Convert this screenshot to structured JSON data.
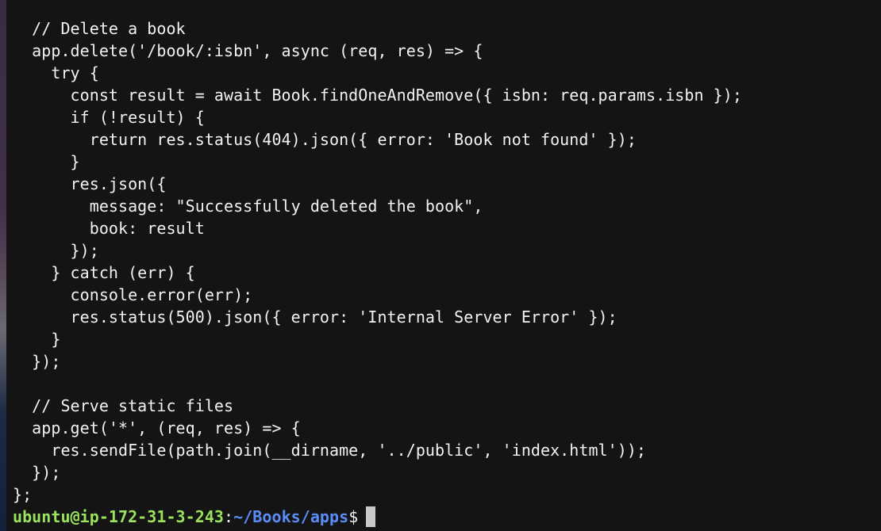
{
  "terminal": {
    "code_lines": [
      "  // Delete a book",
      "  app.delete('/book/:isbn', async (req, res) => {",
      "    try {",
      "      const result = await Book.findOneAndRemove({ isbn: req.params.isbn });",
      "      if (!result) {",
      "        return res.status(404).json({ error: 'Book not found' });",
      "      }",
      "      res.json({",
      "        message: \"Successfully deleted the book\",",
      "        book: result",
      "      });",
      "    } catch (err) {",
      "      console.error(err);",
      "      res.status(500).json({ error: 'Internal Server Error' });",
      "    }",
      "  });",
      "",
      "  // Serve static files",
      "  app.get('*', (req, res) => {",
      "    res.sendFile(path.join(__dirname, '../public', 'index.html'));",
      "  });",
      "};"
    ],
    "prompt": {
      "user_host": "ubuntu@ip-172-31-3-243",
      "colon": ":",
      "path": "~/Books/apps",
      "dollar": "$"
    },
    "colors": {
      "background": "#141414",
      "text": "#f2f2f2",
      "prompt_user": "#9be35c",
      "prompt_path": "#5a8df7",
      "cursor": "#c8c8c8"
    }
  }
}
